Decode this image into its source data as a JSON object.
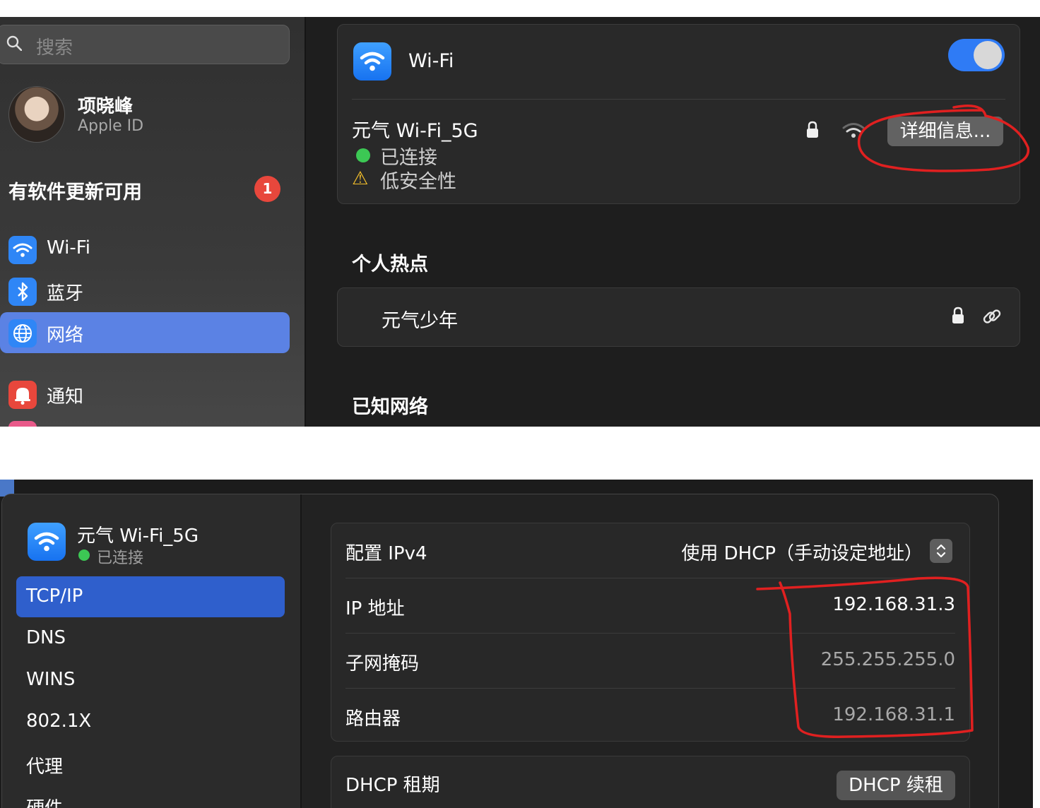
{
  "panel1": {
    "search": {
      "placeholder": "搜索"
    },
    "account": {
      "name": "项晓峰",
      "subtitle": "Apple ID"
    },
    "update": {
      "label": "有软件更新可用",
      "badge": "1"
    },
    "sidebar": {
      "items": [
        {
          "label": "Wi-Fi",
          "icon": "wifi-icon",
          "color": "#2f86f6",
          "selected": false
        },
        {
          "label": "蓝牙",
          "icon": "bluetooth-icon",
          "color": "#2f86f6",
          "selected": false
        },
        {
          "label": "网络",
          "icon": "globe-icon",
          "color": "#2f86f6",
          "selected": true
        },
        {
          "label": "通知",
          "icon": "bell-icon",
          "color": "#e8473c",
          "selected": false
        }
      ]
    },
    "wifi": {
      "title": "Wi-Fi",
      "toggle_on": true,
      "current_network": "元气 Wi-Fi_5G",
      "status": "已连接",
      "warning": "低安全性",
      "details_button": "详细信息..."
    },
    "hotspot": {
      "heading": "个人热点",
      "name": "元气少年"
    },
    "known": {
      "heading": "已知网络"
    }
  },
  "panel2": {
    "network": {
      "name": "元气 Wi-Fi_5G",
      "status": "已连接"
    },
    "tabs": [
      "TCP/IP",
      "DNS",
      "WINS",
      "802.1X",
      "代理",
      "硬件"
    ],
    "selected_tab": "TCP/IP",
    "ipv4": {
      "config_label": "配置 IPv4",
      "config_value": "使用 DHCP（手动设定地址）",
      "rows": [
        {
          "label": "IP 地址",
          "value": "192.168.31.3"
        },
        {
          "label": "子网掩码",
          "value": "255.255.255.0"
        },
        {
          "label": "路由器",
          "value": "192.168.31.1"
        }
      ]
    },
    "dhcp": {
      "label": "DHCP 租期",
      "button": "DHCP 续租"
    }
  },
  "colors": {
    "accent": "#2f7bf5",
    "annotation": "#e02020",
    "connected": "#3cc854",
    "warning": "#f5c02b"
  }
}
